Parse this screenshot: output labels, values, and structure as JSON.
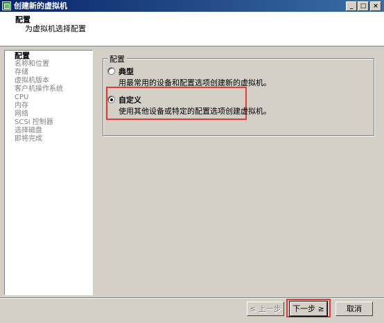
{
  "window": {
    "title": "创建新的虚拟机",
    "minimize": "_",
    "maximize": "□",
    "close": "×"
  },
  "header": {
    "title": "配置",
    "subtitle": "为虚拟机选择配置"
  },
  "nav": {
    "items": [
      {
        "label": "配置",
        "active": true
      },
      {
        "label": "名称和位置"
      },
      {
        "label": "存储"
      },
      {
        "label": "虚拟机版本"
      },
      {
        "label": "客户机操作系统"
      },
      {
        "label": "CPU"
      },
      {
        "label": "内存"
      },
      {
        "label": "网络"
      },
      {
        "label": "SCSI 控制器"
      },
      {
        "label": "选择磁盘"
      },
      {
        "label": "即将完成"
      }
    ]
  },
  "config_group": {
    "legend": "配置",
    "typical": {
      "label": "典型",
      "description": "用最常用的设备和配置选项创建新的虚拟机。",
      "selected": false
    },
    "custom": {
      "label": "自定义",
      "description": "使用其他设备或特定的配置选项创建虚拟机。",
      "selected": true
    }
  },
  "buttons": {
    "back": "≤ 上一步",
    "next": "下一步 ≥",
    "cancel": "取消"
  },
  "colors": {
    "titlebar": "#0a246a",
    "highlight": "#e53935"
  }
}
